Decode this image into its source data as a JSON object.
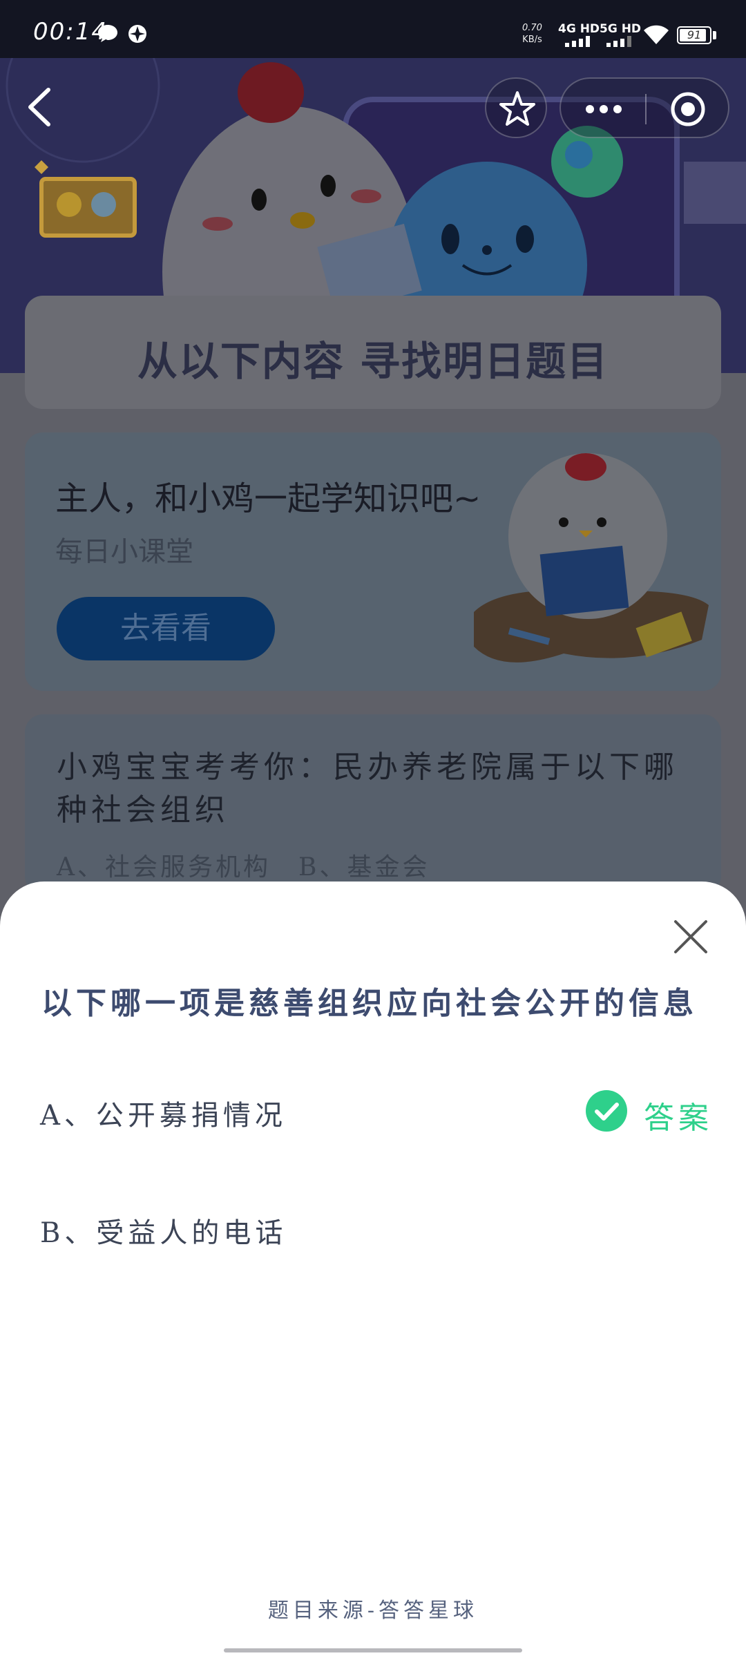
{
  "status_bar": {
    "time": "00:14",
    "net_speed_value": "0.70",
    "net_speed_unit": "KB/s",
    "signal_1": "4G HD",
    "signal_2": "5G HD",
    "battery": "91",
    "battery_level": 0.91
  },
  "hero": {
    "headline": "从以下内容 寻找明日题目"
  },
  "learn_card": {
    "title": "主人，和小鸡一起学知识吧~",
    "subtitle": "每日小课堂",
    "button": "去看看"
  },
  "quiz_card": {
    "question": "小鸡宝宝考考你：民办养老院属于以下哪种社会组织",
    "options": "A、社会服务机构　B、基金会"
  },
  "sheet": {
    "question": "以下哪一项是慈善组织应向社会公开的信息",
    "options": [
      {
        "label": "A、公开募捐情况",
        "is_answer": true
      },
      {
        "label": "B、受益人的电话",
        "is_answer": false
      }
    ],
    "answer_label": "答案",
    "source": "题目来源-答答星球"
  },
  "colors": {
    "accent_green": "#2ed08b",
    "question_color": "#3d4b6f"
  }
}
